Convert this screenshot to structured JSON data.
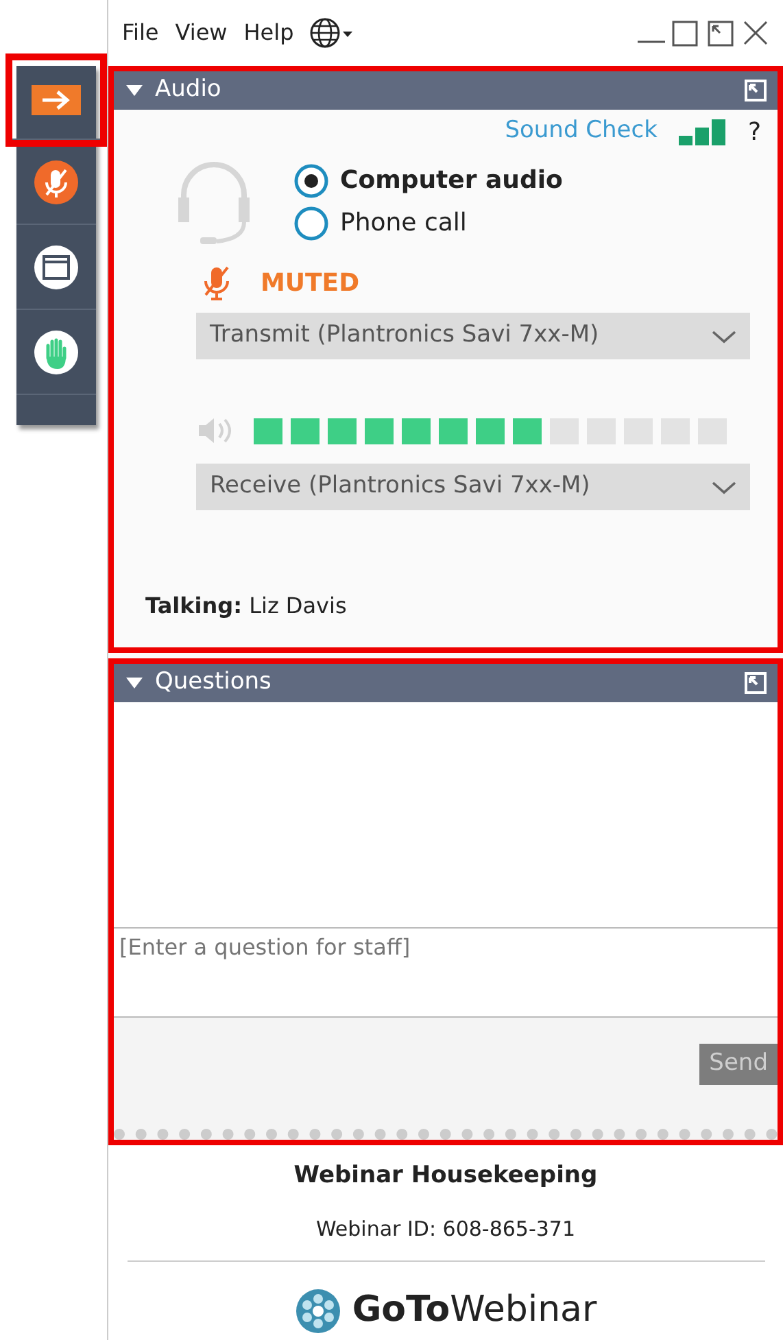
{
  "menu": [
    "File",
    "View",
    "Help"
  ],
  "toolbar": [
    {
      "kind": "arrow",
      "highlighted": true
    },
    {
      "kind": "mic-muted",
      "highlighted": false
    },
    {
      "kind": "window",
      "highlighted": false
    },
    {
      "kind": "hand",
      "highlighted": false
    }
  ],
  "audio": {
    "title": "Audio",
    "expanded": true,
    "highlighted": true,
    "sound_check": "Sound Check",
    "help": "?",
    "options": [
      {
        "label": "Computer audio",
        "selected": true
      },
      {
        "label": "Phone call",
        "selected": false
      }
    ],
    "mute_status": "MUTED",
    "muted": true,
    "transmit": "Transmit (Plantronics Savi 7xx-M)",
    "speaker_meter": {
      "level": 0.615
    },
    "receive": "Receive (Plantronics Savi 7xx-M)",
    "talking_label": "Talking:",
    "talking_name": "Liz Davis"
  },
  "questions": {
    "title": "Questions",
    "expanded": true,
    "highlighted": true,
    "placeholder": "[Enter a question for staff]",
    "send": "Send"
  },
  "footer": {
    "title": "Webinar Housekeeping",
    "webinar_id": "Webinar ID: 608-865-371",
    "logo": "**GoTo**Webinar"
  }
}
